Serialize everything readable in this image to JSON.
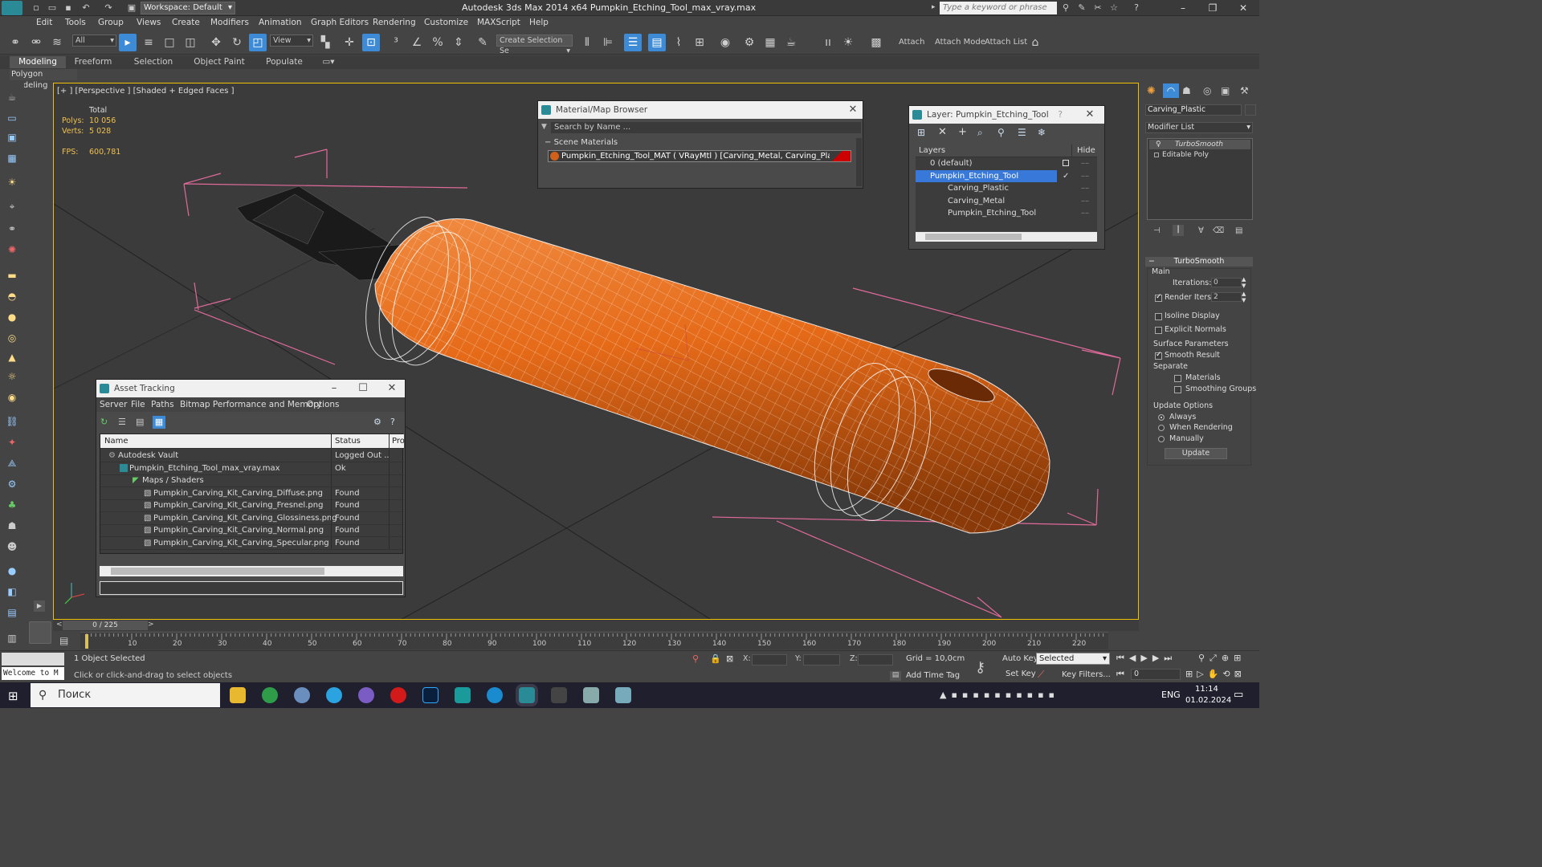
{
  "titlebar": {
    "workspace": "Workspace: Default",
    "title": "Autodesk 3ds Max  2014 x64     Pumpkin_Etching_Tool_max_vray.max",
    "search_placeholder": "Type a keyword or phrase"
  },
  "menu": [
    "Edit",
    "Tools",
    "Group",
    "Views",
    "Create",
    "Modifiers",
    "Animation",
    "Graph Editors",
    "Rendering",
    "Customize",
    "MAXScript",
    "Help"
  ],
  "toolbar": {
    "filter": "All",
    "view": "View",
    "selection_set": "Create Selection Se",
    "attach": "Attach",
    "attach_mode": "Attach Mode",
    "attach_list": "Attach List"
  },
  "ribbon": {
    "tabs": [
      "Modeling",
      "Freeform",
      "Selection",
      "Object Paint",
      "Populate"
    ],
    "panel": "Polygon Modeling"
  },
  "viewport": {
    "label": "[+ ] [Perspective ] [Shaded + Edged Faces ]",
    "stats": {
      "total": "Total",
      "polys_label": "Polys:",
      "polys": "10 056",
      "verts_label": "Verts:",
      "verts": "5 028",
      "fps_label": "FPS:",
      "fps": "600,781"
    }
  },
  "material_browser": {
    "title": "Material/Map Browser",
    "search": "Search by Name ...",
    "section": "Scene Materials",
    "material": "Pumpkin_Etching_Tool_MAT  ( VRayMtl )  [Carving_Metal, Carving_Plastic]",
    "swatch_color": "#cc0000"
  },
  "layer_window": {
    "title": "Layer: Pumpkin_Etching_Tool",
    "help": "?",
    "col_layers": "Layers",
    "col_hide": "Hide",
    "rows": [
      {
        "name": "0 (default)"
      },
      {
        "name": "Pumpkin_Etching_Tool"
      },
      {
        "name": "Carving_Plastic"
      },
      {
        "name": "Carving_Metal"
      },
      {
        "name": "Pumpkin_Etching_Tool"
      }
    ]
  },
  "asset_tracking": {
    "title": "Asset Tracking",
    "menu": [
      "Server",
      "File",
      "Paths",
      "Bitmap Performance and Memory",
      "Options"
    ],
    "columns": [
      "Name",
      "Status",
      "Pro"
    ],
    "rows": [
      {
        "name": "Autodesk Vault",
        "status": "Logged Out ..."
      },
      {
        "name": "Pumpkin_Etching_Tool_max_vray.max",
        "status": "Ok"
      },
      {
        "name": "Maps / Shaders",
        "status": ""
      },
      {
        "name": "Pumpkin_Carving_Kit_Carving_Diffuse.png",
        "status": "Found"
      },
      {
        "name": "Pumpkin_Carving_Kit_Carving_Fresnel.png",
        "status": "Found"
      },
      {
        "name": "Pumpkin_Carving_Kit_Carving_Glossiness.png",
        "status": "Found"
      },
      {
        "name": "Pumpkin_Carving_Kit_Carving_Normal.png",
        "status": "Found"
      },
      {
        "name": "Pumpkin_Carving_Kit_Carving_Specular.png",
        "status": "Found"
      }
    ]
  },
  "command_panel": {
    "object_name": "Carving_Plastic",
    "modifier_list": "Modifier List",
    "stack": [
      "TurboSmooth",
      "Editable Poly"
    ],
    "rollout": "TurboSmooth",
    "main": "Main",
    "iterations_label": "Iterations:",
    "iterations": "0",
    "render_iters_label": "Render Iters:",
    "render_iters": "2",
    "isoline": "Isoline Display",
    "explicit_normals": "Explicit Normals",
    "surface_params": "Surface Parameters",
    "smooth_result": "Smooth Result",
    "separate": "Separate",
    "materials": "Materials",
    "smoothing_groups": "Smoothing Groups",
    "update_options": "Update Options",
    "always": "Always",
    "when_rendering": "When Rendering",
    "manually": "Manually",
    "update_button": "Update"
  },
  "timeline": {
    "frame": "0 / 225",
    "ticks": [
      "10",
      "20",
      "30",
      "40",
      "50",
      "60",
      "70",
      "80",
      "90",
      "100",
      "110",
      "120",
      "130",
      "140",
      "150",
      "160",
      "170",
      "180",
      "190",
      "200",
      "210",
      "220"
    ]
  },
  "status": {
    "selected": "1 Object Selected",
    "prompt": "Click or click-and-drag to select objects",
    "welcome": "Welcome to M",
    "x_label": "X:",
    "y_label": "Y:",
    "z_label": "Z:",
    "grid": "Grid = 10,0cm",
    "add_time_tag": "Add Time Tag",
    "auto_key": "Auto Key",
    "set_key": "Set Key",
    "key_mode": "Selected",
    "key_filters": "Key Filters...",
    "frame_field": "0"
  },
  "taskbar": {
    "search": "Поиск",
    "lang": "ENG",
    "time": "11:14",
    "date": "01.02.2024"
  }
}
